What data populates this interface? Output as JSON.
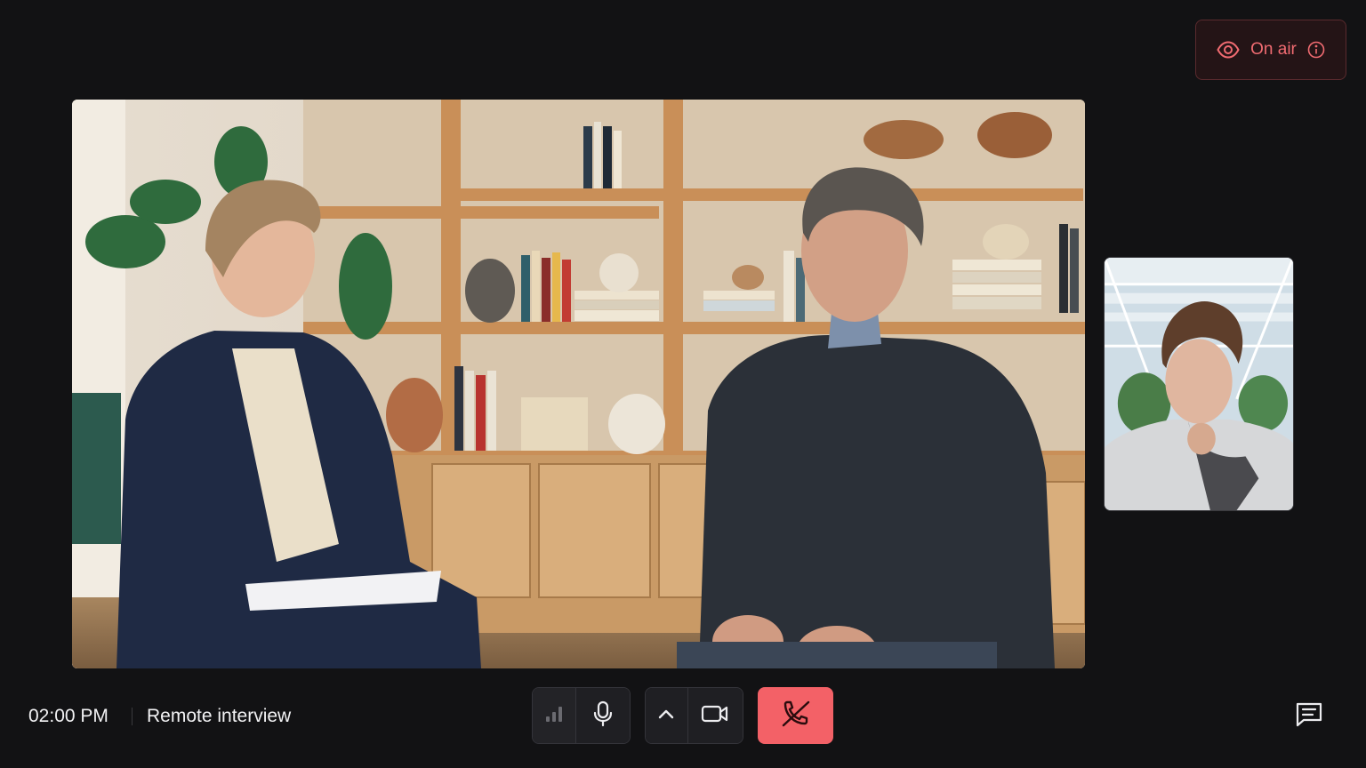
{
  "status": {
    "on_air_label": "On air",
    "accent_color": "#f06b71",
    "icons": [
      "eye-icon",
      "info-icon"
    ]
  },
  "meeting": {
    "time": "02:00 PM",
    "title": "Remote interview"
  },
  "controls": {
    "icons": [
      "signal-strength-icon",
      "microphone-icon",
      "chevron-up-icon",
      "video-camera-icon",
      "end-call-icon",
      "chat-icon"
    ],
    "end_call_color": "#f36167"
  }
}
